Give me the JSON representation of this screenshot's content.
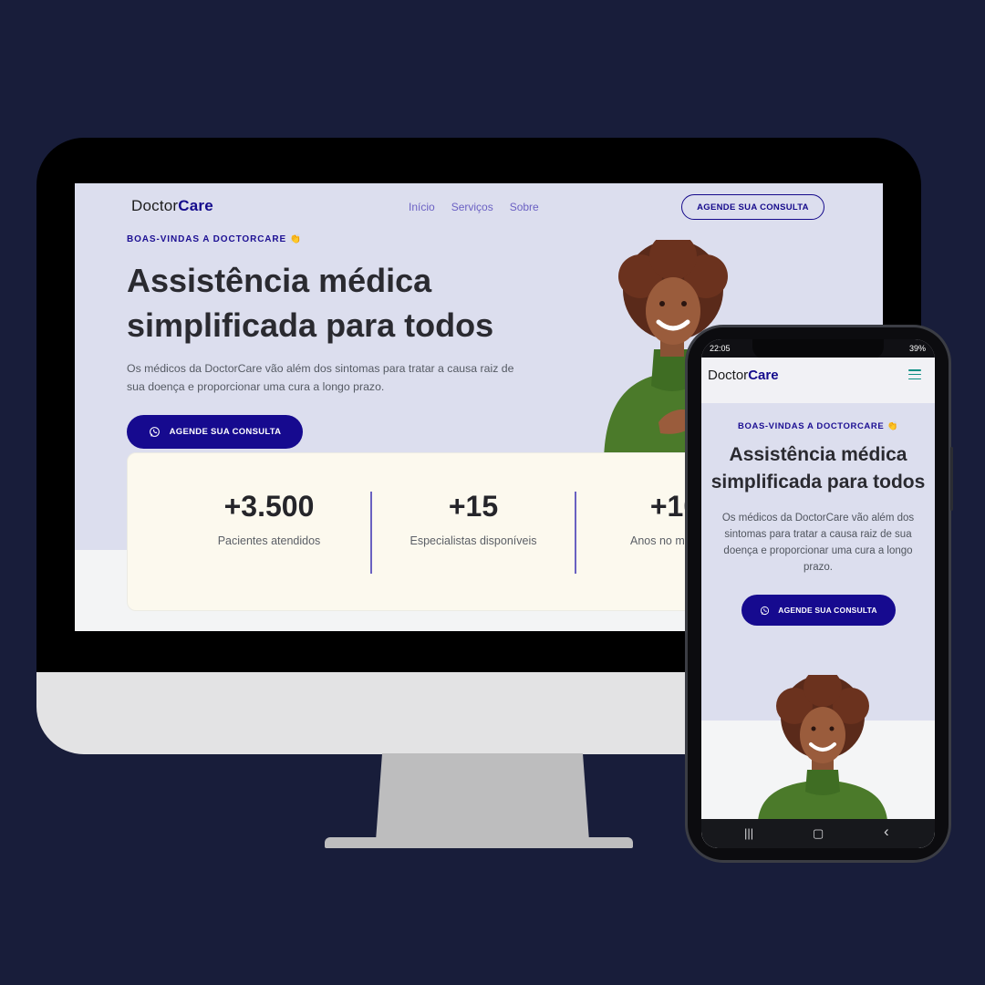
{
  "desktop": {
    "logo": {
      "prefix": "Doctor",
      "suffix": "Care"
    },
    "nav": [
      "Início",
      "Serviços",
      "Sobre"
    ],
    "nav_cta": "AGENDE SUA CONSULTA",
    "tagline": "BOAS-VINDAS A DOCTORCARE 👏",
    "title": "Assistência médica simplificada para todos",
    "description": "Os médicos da DoctorCare vão além dos sintomas para tratar a causa raiz de sua doença e proporcionar uma cura a longo prazo.",
    "cta": "AGENDE SUA CONSULTA",
    "stats": [
      {
        "value": "+3.500",
        "label": "Pacientes atendidos"
      },
      {
        "value": "+15",
        "label": "Especialistas disponíveis"
      },
      {
        "value": "+10",
        "label": "Anos no mercado"
      }
    ]
  },
  "mobile": {
    "status": {
      "time": "22:05",
      "battery": "39%"
    },
    "logo": {
      "prefix": "Doctor",
      "suffix": "Care"
    },
    "tagline": "BOAS-VINDAS A DOCTORCARE 👏",
    "title": "Assistência médica simplificada para todos",
    "description": "Os médicos da DoctorCare vão além dos sintomas para tratar a causa raiz de sua doença e proporcionar uma cura a longo prazo.",
    "cta": "AGENDE SUA CONSULTA",
    "navbar": {
      "recents": "|||",
      "home": "▢",
      "back": "‹"
    }
  },
  "colors": {
    "background": "#181d3a",
    "brand": "#160a8f",
    "hero": "#dcdeee",
    "accent": "#0d8f84"
  },
  "icons": [
    "whatsapp-icon",
    "menu-icon"
  ]
}
